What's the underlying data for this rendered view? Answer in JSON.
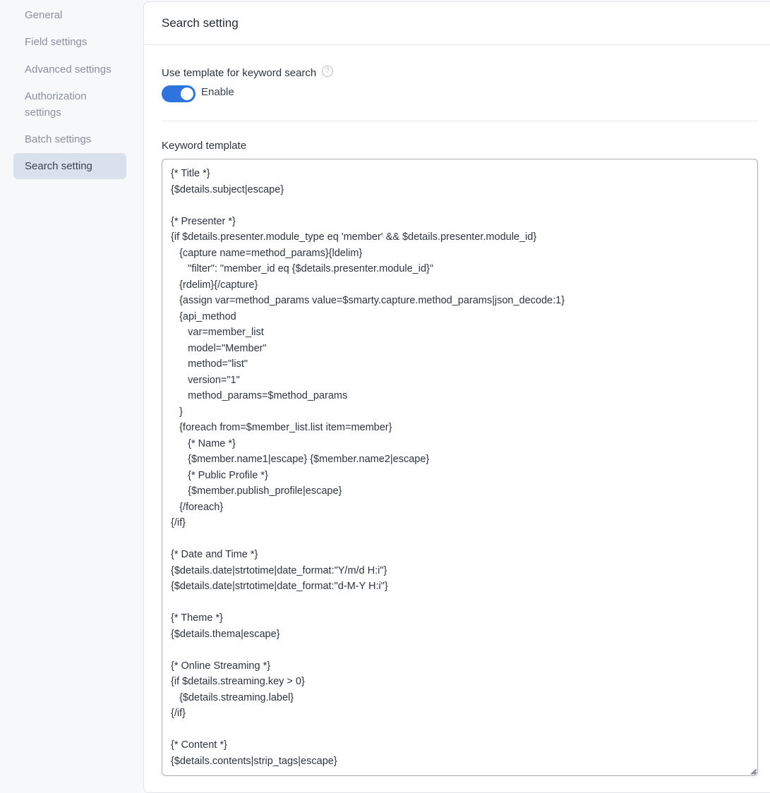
{
  "sidebar": {
    "items": [
      {
        "label": "General",
        "active": false
      },
      {
        "label": "Field settings",
        "active": false
      },
      {
        "label": "Advanced settings",
        "active": false
      },
      {
        "label": "Authorization settings",
        "active": false
      },
      {
        "label": "Batch settings",
        "active": false
      },
      {
        "label": "Search setting",
        "active": true
      }
    ]
  },
  "panel": {
    "title": "Search setting",
    "use_template_label": "Use template for keyword search",
    "help_icon": "question-circle-icon",
    "toggle": {
      "label": "Enable",
      "checked": true,
      "color": "#2f74de"
    },
    "keyword_template_label": "Keyword template",
    "keyword_template_value": "{* Title *}\n{$details.subject|escape}\n\n{* Presenter *}\n{if $details.presenter.module_type eq 'member' && $details.presenter.module_id}\n   {capture name=method_params}{ldelim}\n      \"filter\": \"member_id eq {$details.presenter.module_id}\"\n   {rdelim}{/capture}\n   {assign var=method_params value=$smarty.capture.method_params|json_decode:1}\n   {api_method\n      var=member_list\n      model=\"Member\"\n      method=\"list\"\n      version=\"1\"\n      method_params=$method_params\n   }\n   {foreach from=$member_list.list item=member}\n      {* Name *}\n      {$member.name1|escape} {$member.name2|escape}\n      {* Public Profile *}\n      {$member.publish_profile|escape}\n   {/foreach}\n{/if}\n\n{* Date and Time *}\n{$details.date|strtotime|date_format:\"Y/m/d H:i\"}\n{$details.date|strtotime|date_format:\"d-M-Y H:i\"}\n\n{* Theme *}\n{$details.thema|escape}\n\n{* Online Streaming *}\n{if $details.streaming.key > 0}\n   {$details.streaming.label}\n{/if}\n\n{* Content *}\n{$details.contents|strip_tags|escape}"
  }
}
